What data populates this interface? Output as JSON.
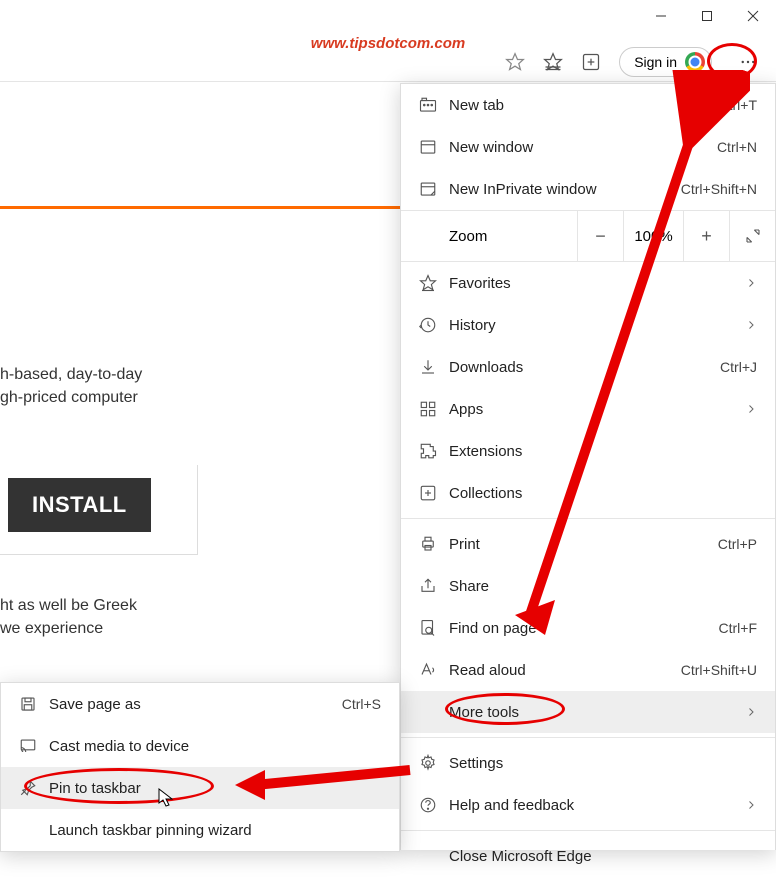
{
  "watermark": "www.tipsdotcom.com",
  "toolbar": {
    "signin_label": "Sign in"
  },
  "page": {
    "frag1_line1": "h-based, day-to-day",
    "frag1_line2": "gh-priced computer",
    "install_label": "INSTALL",
    "frag2_line1": "ht as well be Greek",
    "frag2_line2": " we experience"
  },
  "menu": {
    "new_tab": "New tab",
    "new_tab_sc": "Ctrl+T",
    "new_window": "New window",
    "new_window_sc": "Ctrl+N",
    "inprivate": "New InPrivate window",
    "inprivate_sc": "Ctrl+Shift+N",
    "zoom_label": "Zoom",
    "zoom_pct": "100%",
    "favorites": "Favorites",
    "history": "History",
    "downloads": "Downloads",
    "downloads_sc": "Ctrl+J",
    "apps": "Apps",
    "extensions": "Extensions",
    "collections": "Collections",
    "print": "Print",
    "print_sc": "Ctrl+P",
    "share": "Share",
    "find": "Find on page",
    "find_sc": "Ctrl+F",
    "read_aloud": "Read aloud",
    "read_aloud_sc": "Ctrl+Shift+U",
    "more_tools": "More tools",
    "settings": "Settings",
    "help": "Help and feedback",
    "close_edge": "Close Microsoft Edge"
  },
  "submenu": {
    "save_as": "Save page as",
    "save_as_sc": "Ctrl+S",
    "cast": "Cast media to device",
    "pin": "Pin to taskbar",
    "launch_wizard": "Launch taskbar pinning wizard"
  }
}
